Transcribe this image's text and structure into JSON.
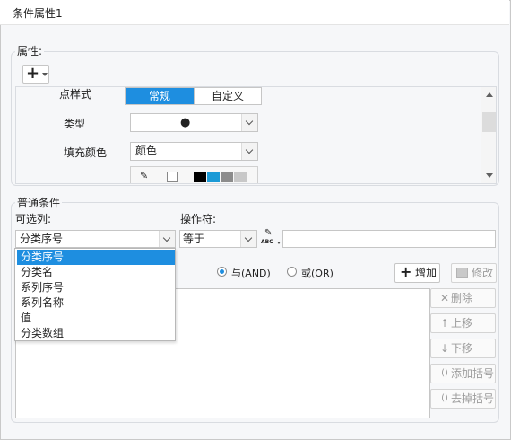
{
  "dialog": {
    "title": "条件属性1"
  },
  "properties": {
    "group_label": "属性:",
    "add_glyph": "+",
    "point_style_label": "点样式",
    "tabs": [
      {
        "label": "常规",
        "active": true
      },
      {
        "label": "自定义",
        "active": false
      }
    ],
    "type_label": "类型",
    "type_value": "●",
    "fill_color_label": "填充颜色",
    "fill_color_value": "颜色",
    "swatches": [
      "#000000",
      "#1b9ad6",
      "#8c8c8c",
      "#c8c8c8"
    ]
  },
  "condition": {
    "group_label": "普通条件",
    "optional_columns_label": "可选列:",
    "operator_label": "操作符:",
    "column_value": "分类序号",
    "operator_value": "等于",
    "formula_icon_text": "ABC",
    "value_input": "",
    "dropdown_options": [
      {
        "label": "分类序号",
        "selected": true
      },
      {
        "label": "分类名",
        "selected": false
      },
      {
        "label": "系列序号",
        "selected": false
      },
      {
        "label": "系列名称",
        "selected": false
      },
      {
        "label": "值",
        "selected": false
      },
      {
        "label": "分类数组",
        "selected": false
      }
    ],
    "and_label": "与(AND)",
    "or_label": "或(OR)",
    "logic_selected": "and",
    "add_button": "增加",
    "modify_button": "修改",
    "side_buttons": [
      {
        "label": "删除",
        "icon": "delete-icon",
        "glyph": "✕"
      },
      {
        "label": "上移",
        "icon": "arrow-up-icon",
        "glyph": "↑"
      },
      {
        "label": "下移",
        "icon": "arrow-down-icon",
        "glyph": "↓"
      },
      {
        "label": "添加括号",
        "icon": "brackets-icon",
        "glyph": "()"
      },
      {
        "label": "去掉括号",
        "icon": "remove-brackets-icon",
        "glyph": "()"
      }
    ]
  },
  "colors": {
    "accent": "#1e8ee0",
    "border": "#c6c6c6",
    "panel": "#f6f7f9"
  }
}
